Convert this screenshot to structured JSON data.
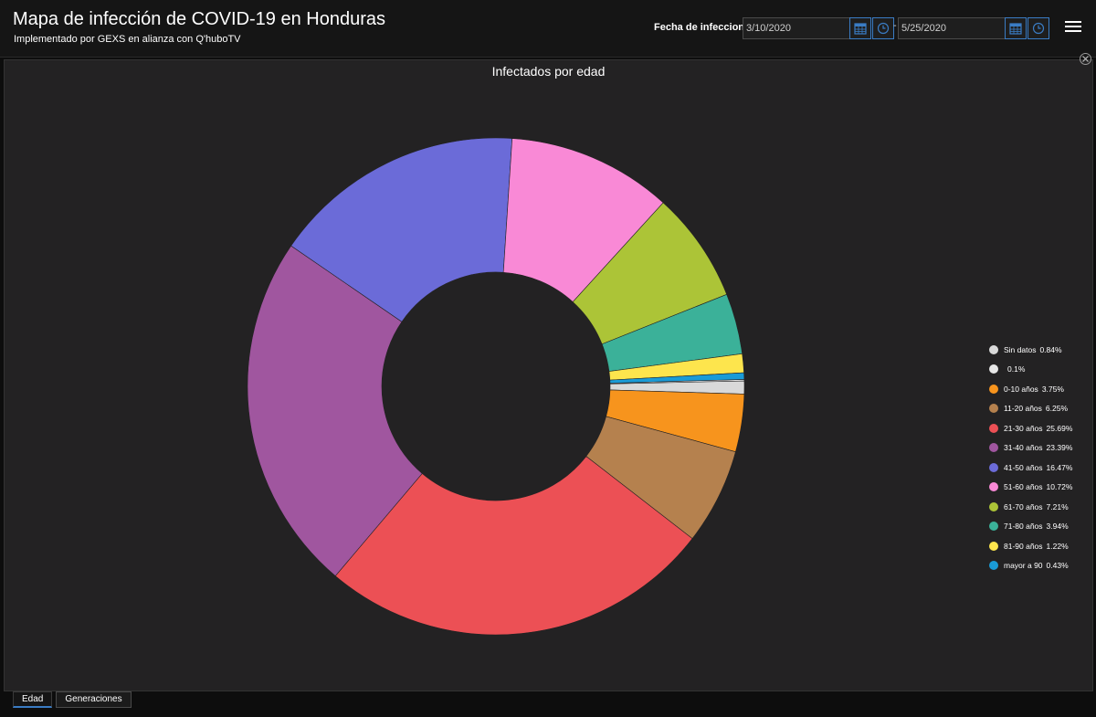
{
  "header": {
    "title": "Mapa de infección de COVID-19 en Honduras",
    "subtitle": "Implementado por GEXS en alianza con Q'huboTV",
    "date_label": "Fecha de infeccion",
    "date_start": "3/10/2020",
    "date_end": "5/25/2020",
    "date_separator": "-"
  },
  "icons": {
    "calendar": "calendar-icon",
    "clock": "clock-icon",
    "menu": "hamburger-menu-icon",
    "close": "close-icon"
  },
  "tabs": [
    {
      "label": "Edad",
      "active": true
    },
    {
      "label": "Generaciones",
      "active": false
    }
  ],
  "chart_data": {
    "type": "pie",
    "title": "Infectados por edad",
    "donut": true,
    "legend_position": "right",
    "slices": [
      {
        "label": "Sin datos",
        "pct_label": "0.84%",
        "value": 0.84,
        "color": "#d9d9d9"
      },
      {
        "label": "",
        "pct_label": "0.1%",
        "value": 0.1,
        "color": "#e6e6e6"
      },
      {
        "label": "0-10 años",
        "pct_label": "3.75%",
        "value": 3.75,
        "color": "#f7941d"
      },
      {
        "label": "11-20 años",
        "pct_label": "6.25%",
        "value": 6.25,
        "color": "#b5814e"
      },
      {
        "label": "21-30 años",
        "pct_label": "25.69%",
        "value": 25.69,
        "color": "#ec5055"
      },
      {
        "label": "31-40 años",
        "pct_label": "23.39%",
        "value": 23.39,
        "color": "#a0569f"
      },
      {
        "label": "41-50 años",
        "pct_label": "16.47%",
        "value": 16.47,
        "color": "#6b6bd8"
      },
      {
        "label": "51-60 años",
        "pct_label": "10.72%",
        "value": 10.72,
        "color": "#f989d6"
      },
      {
        "label": "61-70 años",
        "pct_label": "7.21%",
        "value": 7.21,
        "color": "#acc437"
      },
      {
        "label": "71-80 años",
        "pct_label": "3.94%",
        "value": 3.94,
        "color": "#3bb199"
      },
      {
        "label": "81-90 años",
        "pct_label": "1.22%",
        "value": 1.22,
        "color": "#fde54d"
      },
      {
        "label": "mayor a 90",
        "pct_label": "0.43%",
        "value": 0.43,
        "color": "#1a9bd7"
      }
    ],
    "legend_order": [
      0,
      1,
      2,
      3,
      4,
      5,
      6,
      7,
      8,
      9,
      10,
      11
    ]
  }
}
